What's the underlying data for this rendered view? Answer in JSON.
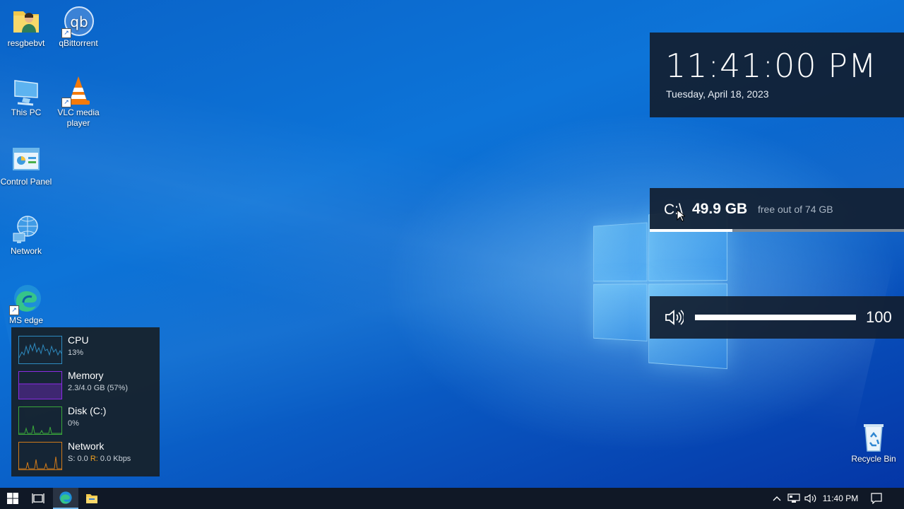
{
  "desktop": {
    "icons": [
      {
        "label": "resgbebvt"
      },
      {
        "label": "qBittorrent"
      },
      {
        "label": "This PC"
      },
      {
        "label": "VLC media player"
      },
      {
        "label": "Control Panel"
      },
      {
        "label": "Network"
      },
      {
        "label": "MS edge"
      },
      {
        "label": "Recycle Bin"
      }
    ]
  },
  "clock_widget": {
    "time": "11:41:00 PM",
    "date": "Tuesday, April 18, 2023"
  },
  "disk_widget": {
    "drive": "C:\\",
    "free": "49.9 GB",
    "total_text": "free out of 74 GB",
    "used_fraction": 0.326
  },
  "volume_widget": {
    "value": "100",
    "level_fraction": 1.0
  },
  "resource_monitor": {
    "rows": [
      {
        "name": "CPU",
        "detail": "13%",
        "color": "#2e8bc0"
      },
      {
        "name": "Memory",
        "detail": "2.3/4.0 GB (57%)",
        "color": "#8a2be2"
      },
      {
        "name": "Disk (C:)",
        "detail": "0%",
        "color": "#3aa83a"
      },
      {
        "name": "Network",
        "s_label": "S:",
        "s_value": "0.0",
        "r_label": "R:",
        "r_value": "0.0 Kbps",
        "color": "#d07a1a"
      }
    ]
  },
  "taskbar": {
    "clock": "11:40 PM"
  },
  "colors": {
    "accent": "#76b9ed",
    "taskbar": "#101826",
    "panel": "#121e30"
  }
}
